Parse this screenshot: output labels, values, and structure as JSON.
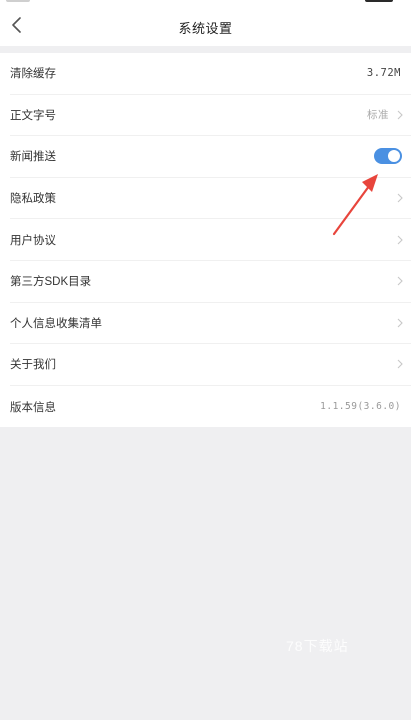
{
  "header": {
    "title": "系统设置"
  },
  "settings": {
    "items": [
      {
        "label": "清除缓存",
        "value": "3.72M"
      },
      {
        "label": "正文字号",
        "value": "标准"
      },
      {
        "label": "新闻推送",
        "toggle": true
      },
      {
        "label": "隐私政策"
      },
      {
        "label": "用户协议"
      },
      {
        "label": "第三方SDK目录"
      },
      {
        "label": "个人信息收集清单"
      },
      {
        "label": "关于我们"
      },
      {
        "label": "版本信息",
        "value": "1.1.59(3.6.0)"
      }
    ]
  },
  "watermark": "78下载站",
  "colors": {
    "toggle_on": "#4a90e2",
    "annotation_arrow": "#e8453c"
  },
  "icons": {
    "back": "chevron-left-icon",
    "row_more": "chevron-right-icon"
  }
}
